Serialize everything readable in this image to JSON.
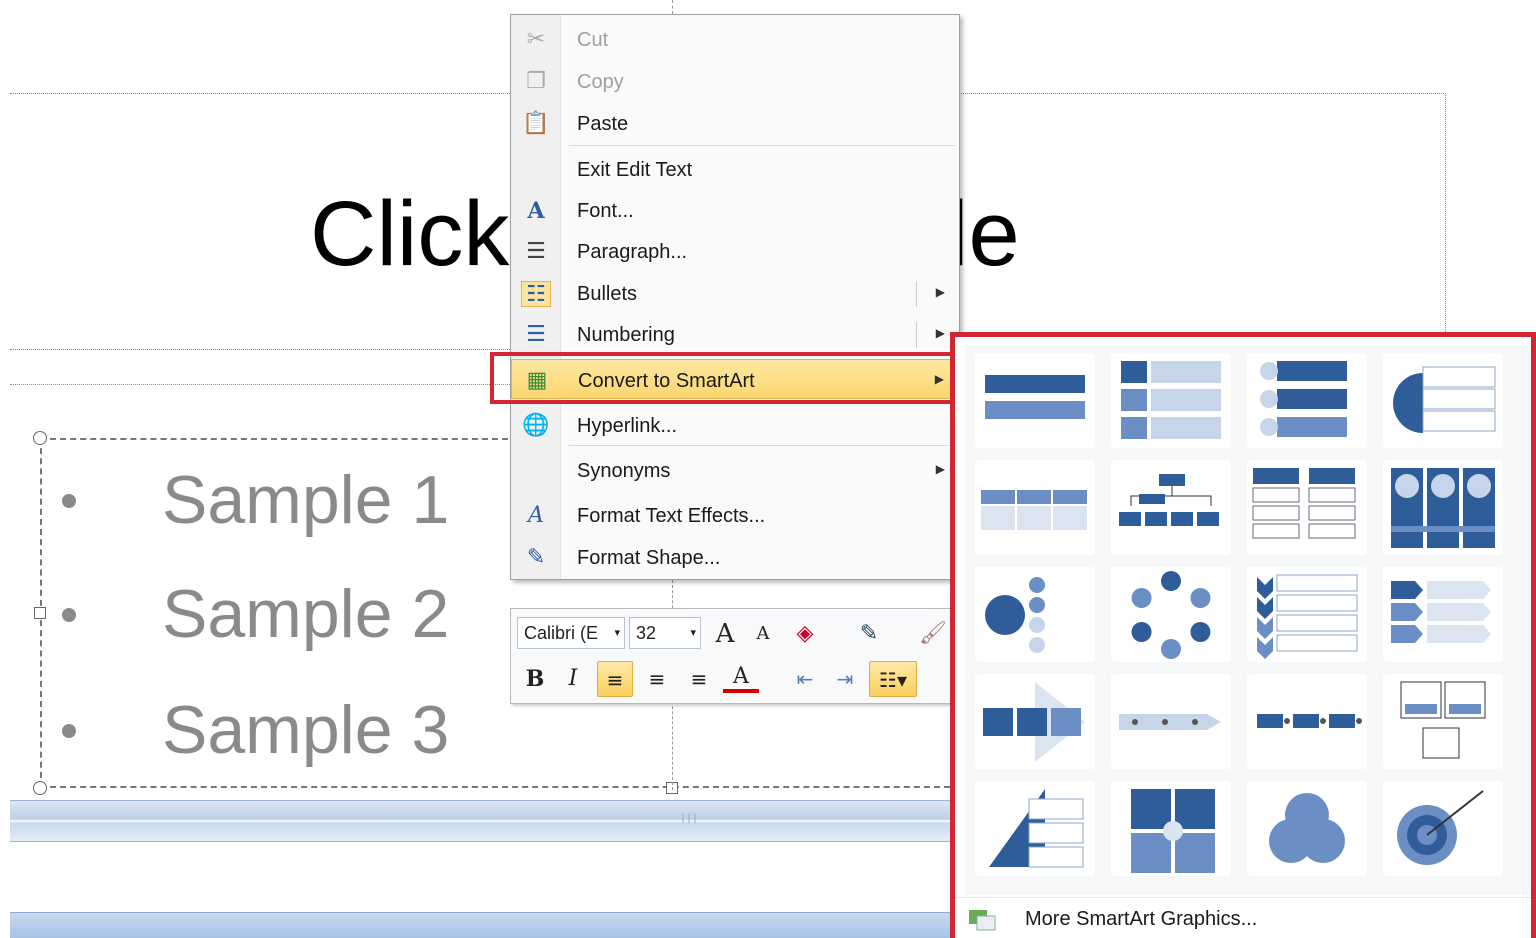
{
  "slide": {
    "title_left": "Click",
    "title_right": "le",
    "bullets": [
      {
        "label": "Sample 1"
      },
      {
        "label": "Sample 2"
      },
      {
        "label": "Sample 3"
      }
    ]
  },
  "context_menu": {
    "items": [
      {
        "label": "Cut",
        "icon": "scissors-icon",
        "enabled": false
      },
      {
        "label": "Copy",
        "icon": "copy-icon",
        "enabled": false
      },
      {
        "label": "Paste",
        "icon": "paste-icon",
        "enabled": true
      },
      {
        "label": "Exit Edit Text",
        "icon": "",
        "enabled": true
      },
      {
        "label": "Font...",
        "icon": "font-icon",
        "enabled": true
      },
      {
        "label": "Paragraph...",
        "icon": "paragraph-icon",
        "enabled": true
      },
      {
        "label": "Bullets",
        "icon": "bullets-icon",
        "enabled": true,
        "submenu": true
      },
      {
        "label": "Numbering",
        "icon": "numbering-icon",
        "enabled": true,
        "submenu": true
      },
      {
        "label": "Convert to SmartArt",
        "icon": "smartart-icon",
        "enabled": true,
        "submenu": true,
        "highlighted": true
      },
      {
        "label": "Hyperlink...",
        "icon": "hyperlink-icon",
        "enabled": true
      },
      {
        "label": "Synonyms",
        "icon": "",
        "enabled": true,
        "submenu": true
      },
      {
        "label": "Format Text Effects...",
        "icon": "text-effects-icon",
        "enabled": true
      },
      {
        "label": "Format Shape...",
        "icon": "format-shape-icon",
        "enabled": true
      }
    ]
  },
  "mini_toolbar": {
    "font_name": "Calibri (E",
    "font_size": "32",
    "grow_font": "A",
    "shrink_font": "A",
    "bold": "B",
    "italic": "I",
    "font_color": "A"
  },
  "smartart_gallery": {
    "more_label": "More SmartArt Graphics...",
    "layouts": [
      "basic-block-list",
      "vertical-bullet-list",
      "vertical-box-list",
      "circle-list",
      "horizontal-bullet-list",
      "organization-chart",
      "table-list",
      "picture-list",
      "radial-cluster",
      "basic-cycle",
      "vertical-chevron-list",
      "vertical-arrow-list",
      "basic-process",
      "timeline",
      "alternating-flow",
      "picture-caption",
      "pyramid-list",
      "matrix",
      "venn",
      "target"
    ]
  },
  "colors": {
    "accent_red": "#d42632",
    "smartart_blue": "#2f5d9a",
    "highlight": "#fbd66f"
  }
}
